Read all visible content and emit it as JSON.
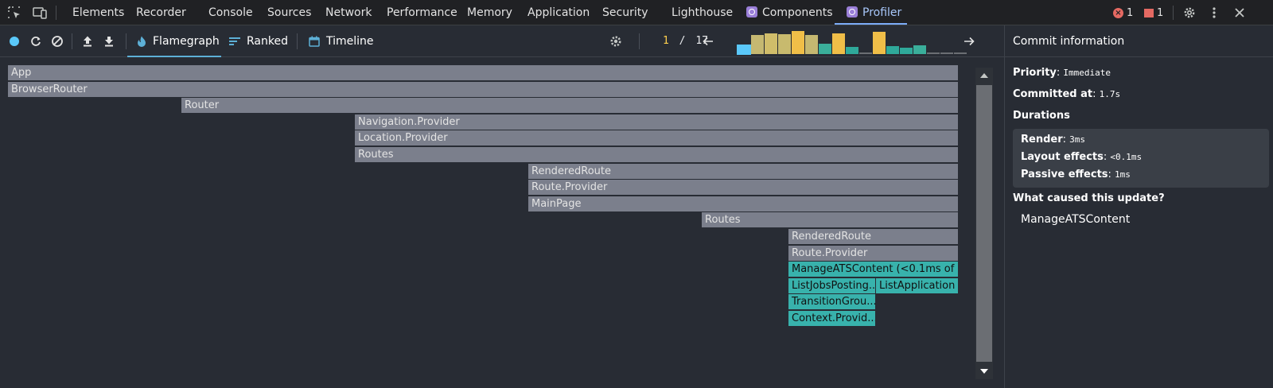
{
  "devtools": {
    "tabs": [
      {
        "label": "Elements",
        "active": false
      },
      {
        "label": "Recorder",
        "active": false
      },
      {
        "label": "Console",
        "active": false
      },
      {
        "label": "Sources",
        "active": false
      },
      {
        "label": "Network",
        "active": false
      },
      {
        "label": "Performance",
        "active": false
      },
      {
        "label": "Memory",
        "active": false
      },
      {
        "label": "Application",
        "active": false
      },
      {
        "label": "Security",
        "active": false
      },
      {
        "label": "Lighthouse",
        "active": false
      },
      {
        "label": "Components",
        "active": false,
        "icon": "react-icon"
      },
      {
        "label": "Profiler",
        "active": true,
        "icon": "react-icon"
      }
    ],
    "error_count": "1",
    "issue_count": "1"
  },
  "toolbar": {
    "tabs": [
      {
        "label": "Flamegraph",
        "icon": "flame-icon",
        "active": true
      },
      {
        "label": "Ranked",
        "icon": "ranked-icon",
        "active": false
      },
      {
        "label": "Timeline",
        "icon": "timeline-icon",
        "active": false
      }
    ],
    "commit_current": "1",
    "commit_separator": "/",
    "commit_total": "17"
  },
  "commits": [
    {
      "value": 0.35,
      "color": "#5ac8fa",
      "selected": true
    },
    {
      "value": 0.8,
      "color": "#c5b871"
    },
    {
      "value": 0.88,
      "color": "#d0bd6a"
    },
    {
      "value": 0.82,
      "color": "#c8ba6e"
    },
    {
      "value": 0.95,
      "color": "#f0be48"
    },
    {
      "value": 0.8,
      "color": "#c5b871"
    },
    {
      "value": 0.42,
      "color": "#3aae9a"
    },
    {
      "value": 0.88,
      "color": "#f0be48"
    },
    {
      "value": 0.3,
      "color": "#2fa99a"
    },
    {
      "value": 0.06,
      "color": "#6b6e73"
    },
    {
      "value": 0.92,
      "color": "#f0be48"
    },
    {
      "value": 0.34,
      "color": "#2fa99a"
    },
    {
      "value": 0.27,
      "color": "#2fa99a"
    },
    {
      "value": 0.36,
      "color": "#3aae9a"
    },
    {
      "value": 0.06,
      "color": "#6b6e73"
    },
    {
      "value": 0.06,
      "color": "#6b6e73"
    },
    {
      "value": 0.06,
      "color": "#6b6e73"
    }
  ],
  "flamegraph": {
    "nodes": [
      {
        "label": "App",
        "depth": 0,
        "start": 0.0,
        "end": 1.0,
        "color": "gray"
      },
      {
        "label": "BrowserRouter",
        "depth": 1,
        "start": 0.0,
        "end": 1.0,
        "color": "gray"
      },
      {
        "label": "Router",
        "depth": 2,
        "start": 0.1826,
        "end": 1.0,
        "color": "gray"
      },
      {
        "label": "Navigation.Provider",
        "depth": 3,
        "start": 0.3648,
        "end": 1.0,
        "color": "gray"
      },
      {
        "label": "Location.Provider",
        "depth": 4,
        "start": 0.3648,
        "end": 1.0,
        "color": "gray"
      },
      {
        "label": "Routes",
        "depth": 5,
        "start": 0.3648,
        "end": 1.0,
        "color": "gray"
      },
      {
        "label": "RenderedRoute",
        "depth": 6,
        "start": 0.547,
        "end": 1.0,
        "color": "gray"
      },
      {
        "label": "Route.Provider",
        "depth": 7,
        "start": 0.547,
        "end": 1.0,
        "color": "gray"
      },
      {
        "label": "MainPage",
        "depth": 8,
        "start": 0.547,
        "end": 1.0,
        "color": "gray"
      },
      {
        "label": "Routes",
        "depth": 9,
        "start": 0.73,
        "end": 1.0,
        "color": "gray"
      },
      {
        "label": "RenderedRoute",
        "depth": 10,
        "start": 0.8211,
        "end": 1.0,
        "color": "gray"
      },
      {
        "label": "Route.Provider",
        "depth": 11,
        "start": 0.8211,
        "end": 1.0,
        "color": "gray"
      },
      {
        "label": "ManageATSContent (<0.1ms of",
        "depth": 12,
        "start": 0.8211,
        "end": 1.0,
        "color": "teal"
      },
      {
        "label": "ListJobsPosting...",
        "depth": 13,
        "start": 0.8211,
        "end": 0.913,
        "color": "teal"
      },
      {
        "label": "ListApplication",
        "depth": 13,
        "start": 0.913,
        "end": 1.0,
        "color": "teal"
      },
      {
        "label": "TransitionGrou...",
        "depth": 14,
        "start": 0.8211,
        "end": 0.913,
        "color": "teal"
      },
      {
        "label": "Context.Provid...",
        "depth": 15,
        "start": 0.8211,
        "end": 0.913,
        "color": "teal"
      }
    ]
  },
  "commit_info": {
    "title": "Commit information",
    "priority_label": "Priority",
    "priority_value": "Immediate",
    "committed_label": "Committed at",
    "committed_value": "1.7s",
    "durations_label": "Durations",
    "render_label": "Render",
    "render_value": "3ms",
    "layout_label": "Layout effects",
    "layout_value": "<0.1ms",
    "passive_label": "Passive effects",
    "passive_value": "1ms",
    "cause_label": "What caused this update?",
    "cause_value": "ManageATSContent"
  }
}
